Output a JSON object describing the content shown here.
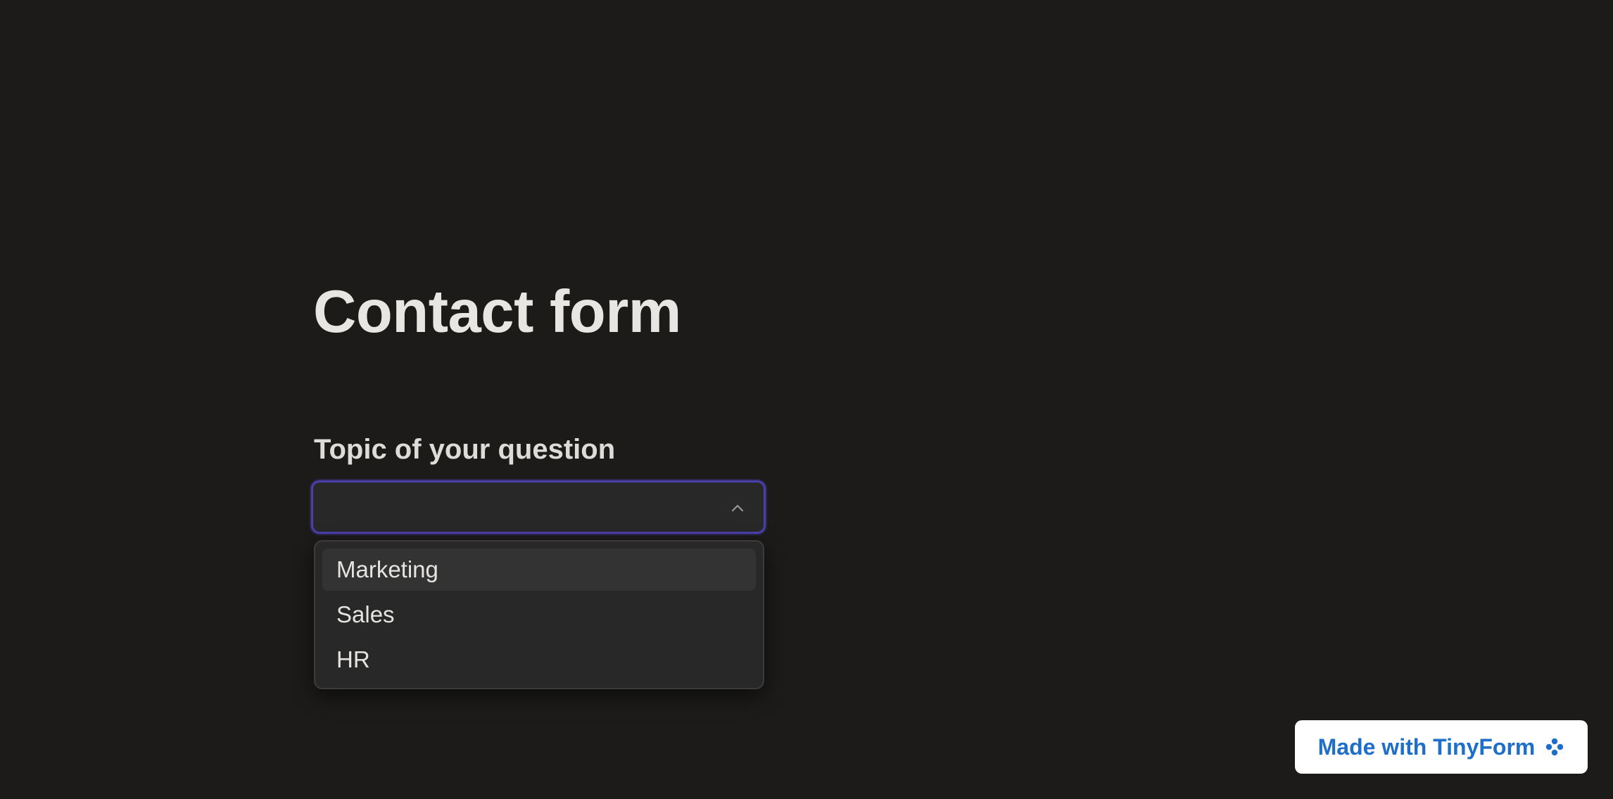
{
  "form": {
    "title": "Contact form"
  },
  "topic_field": {
    "label": "Topic of your question",
    "value": "",
    "expanded": true,
    "options": [
      {
        "label": "Marketing",
        "highlighted": true
      },
      {
        "label": "Sales",
        "highlighted": false
      },
      {
        "label": "HR",
        "highlighted": false
      }
    ]
  },
  "footer": {
    "badge_label": "Made with TinyForm",
    "badge_icon": "tinyform-flower-icon"
  },
  "colors": {
    "background": "#1c1b1a",
    "focus_ring": "#4b3fae",
    "badge_text": "#1e6fc9"
  }
}
